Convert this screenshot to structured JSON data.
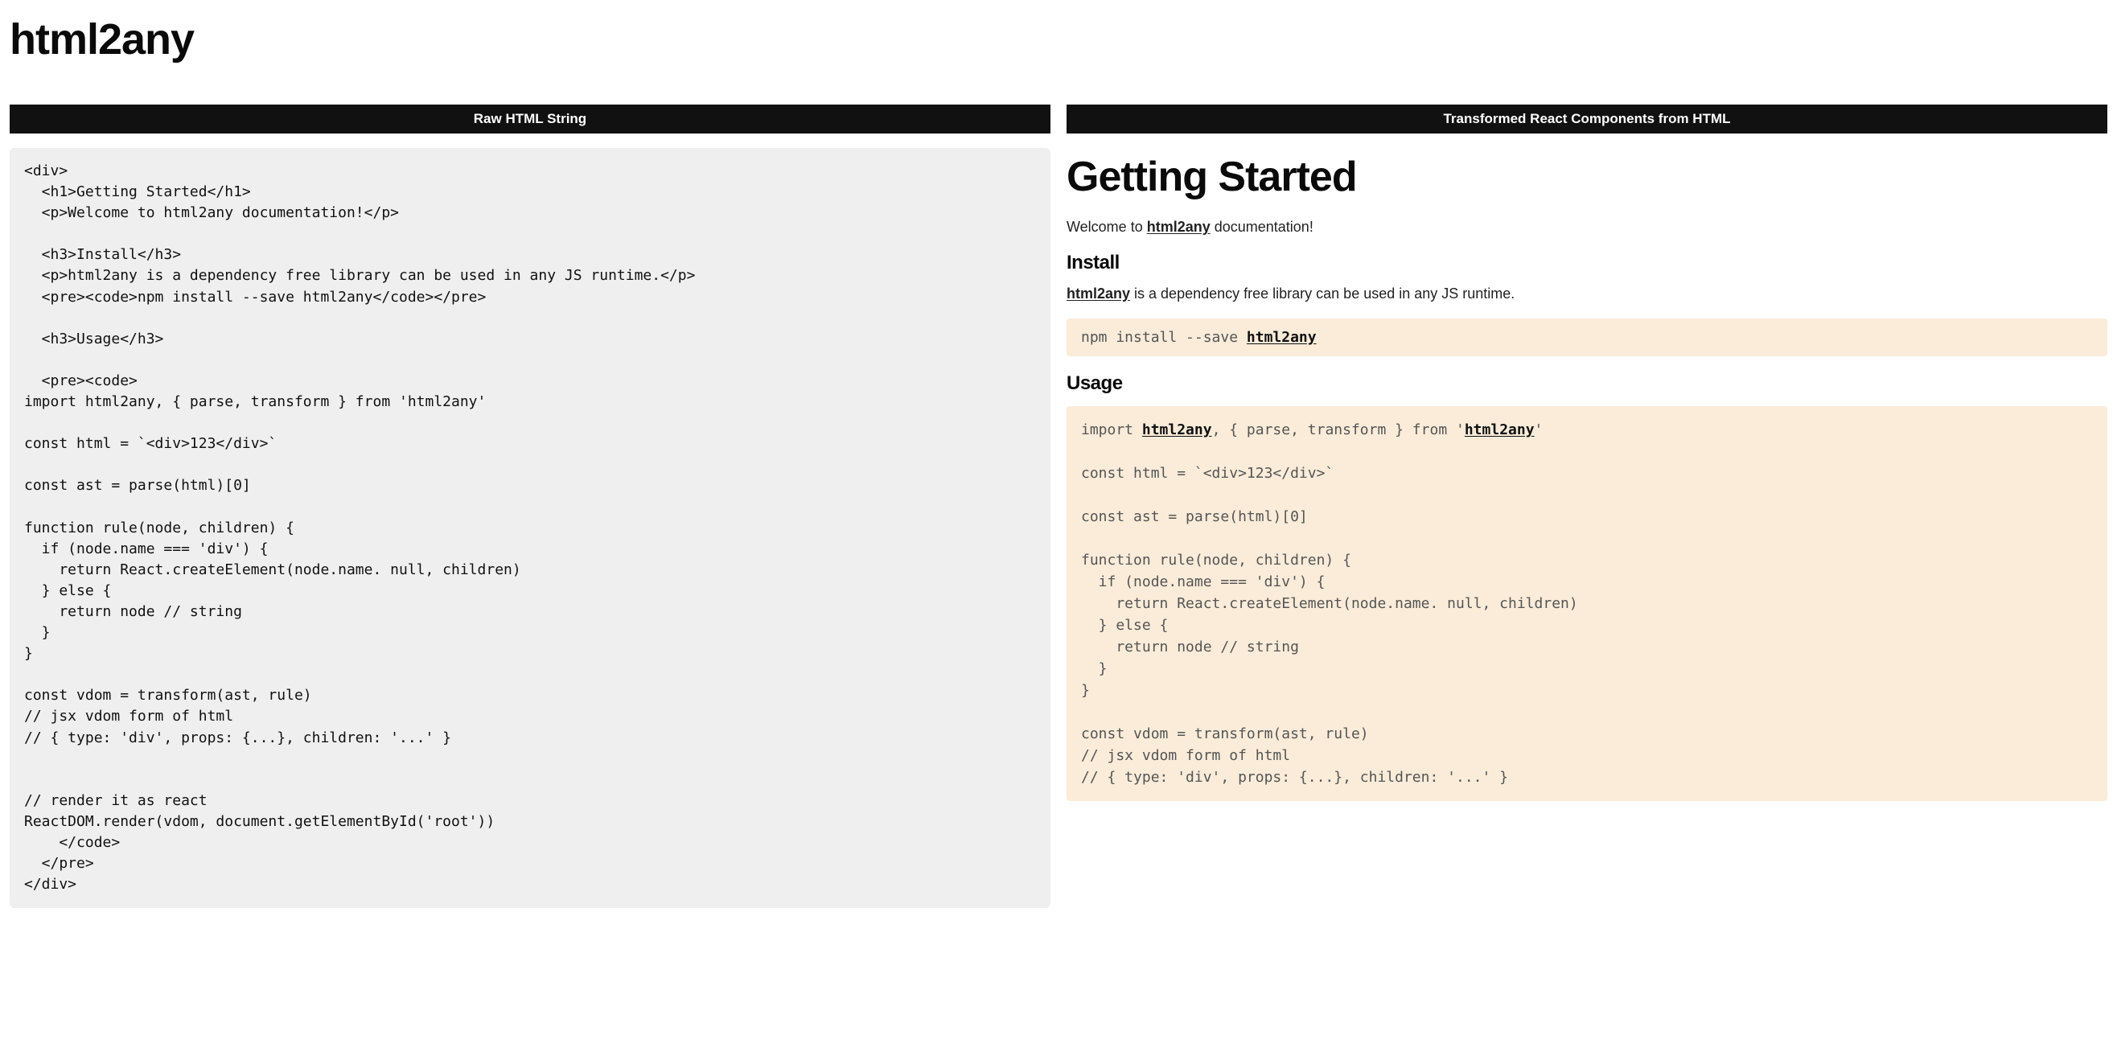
{
  "page_title": "html2any",
  "left": {
    "header": "Raw HTML String",
    "code": "<div>\n  <h1>Getting Started</h1>\n  <p>Welcome to html2any documentation!</p>\n\n  <h3>Install</h3>\n  <p>html2any is a dependency free library can be used in any JS runtime.</p>\n  <pre><code>npm install --save html2any</code></pre>\n\n  <h3>Usage</h3>\n\n  <pre><code>\nimport html2any, { parse, transform } from 'html2any'\n\nconst html = `<div>123</div>`\n\nconst ast = parse(html)[0]\n\nfunction rule(node, children) {\n  if (node.name === 'div') {\n    return React.createElement(node.name. null, children)\n  } else {\n    return node // string\n  }\n}\n\nconst vdom = transform(ast, rule)\n// jsx vdom form of html\n// { type: 'div', props: {...}, children: '...' }\n\n\n// render it as react\nReactDOM.render(vdom, document.getElementById('root'))\n    </code>\n  </pre>\n</div>"
  },
  "right": {
    "header": "Transformed React Components from HTML",
    "h1": "Getting Started",
    "welcome_pre": "Welcome to ",
    "welcome_kw": "html2any",
    "welcome_post": " documentation!",
    "install_h3": "Install",
    "install_p_kw": "html2any",
    "install_p_post": " is a dependency free library can be used in any JS runtime.",
    "install_code_pre": "npm install --save ",
    "install_code_kw": "html2any",
    "usage_h3": "Usage",
    "usage_code_l1_pre": "import ",
    "usage_code_l1_kw1": "html2any",
    "usage_code_l1_mid": ", { parse, transform } from '",
    "usage_code_l1_kw2": "html2any",
    "usage_code_l1_post": "'",
    "usage_code_rest": "\n\nconst html = `<div>123</div>`\n\nconst ast = parse(html)[0]\n\nfunction rule(node, children) {\n  if (node.name === 'div') {\n    return React.createElement(node.name. null, children)\n  } else {\n    return node // string\n  }\n}\n\nconst vdom = transform(ast, rule)\n// jsx vdom form of html\n// { type: 'div', props: {...}, children: '...' }"
  }
}
